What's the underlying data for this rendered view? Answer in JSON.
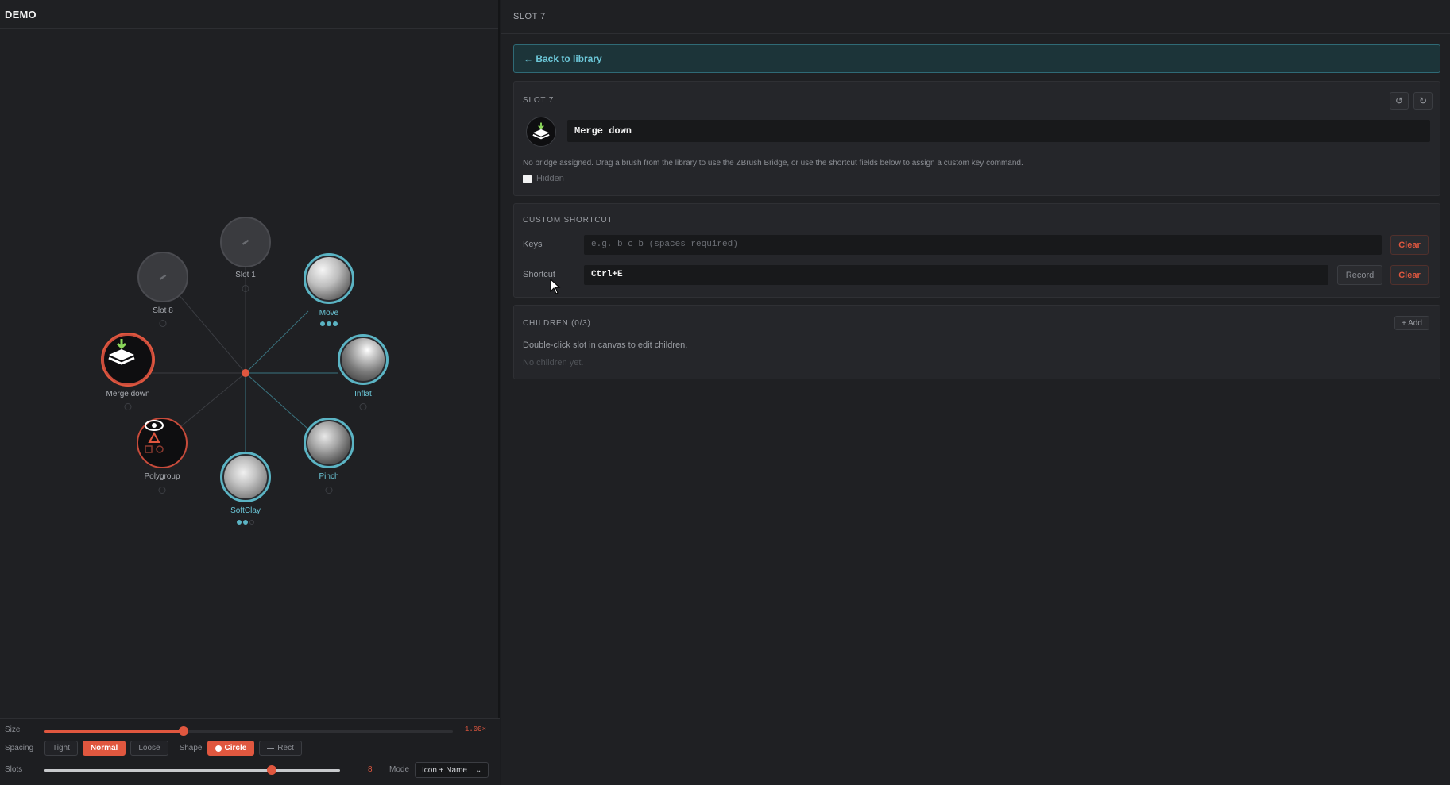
{
  "left_title": "DEMO",
  "canvas": {
    "slots": [
      {
        "label": "Slot 1",
        "kind": "empty"
      },
      {
        "label": "Move",
        "kind": "brush"
      },
      {
        "label": "Inflat",
        "kind": "brush"
      },
      {
        "label": "Pinch",
        "kind": "brush"
      },
      {
        "label": "SoftClay",
        "kind": "brush"
      },
      {
        "label": "Polygroup",
        "kind": "command",
        "icon": "eye-triangle-squares-icon"
      },
      {
        "label": "Merge down",
        "kind": "command",
        "icon": "layers-merge-icon",
        "active": true
      },
      {
        "label": "Slot 8",
        "kind": "empty"
      }
    ]
  },
  "controls": {
    "size_label": "Size",
    "size_value_text": "1.00×",
    "size_fraction": 0.34,
    "spacing_label": "Spacing",
    "spacing_options": [
      "Tight",
      "Normal",
      "Loose"
    ],
    "spacing_selected": "Normal",
    "shape_label": "Shape",
    "shape_circle": "Circle",
    "shape_rect": "Rect",
    "shape_selected": "Circle",
    "slots_label": "Slots",
    "slots_value": "8",
    "slots_fraction": 0.77,
    "mode_label": "Mode",
    "mode_value": "Icon + Name"
  },
  "right": {
    "header": "SLOT 7",
    "back_label": "← Back to library",
    "slot_card": {
      "title": "SLOT 7",
      "name_value": "Merge down",
      "help_text": "No bridge assigned. Drag a brush from the library to use the ZBrush Bridge, or use the shortcut fields below to assign a custom key command.",
      "hidden_label": "Hidden"
    },
    "shortcut_card": {
      "title": "CUSTOM SHORTCUT",
      "keys_label": "Keys",
      "keys_placeholder": "e.g. b c b (spaces required)",
      "shortcut_label": "Shortcut",
      "shortcut_value": "Ctrl+E",
      "record_label": "Record",
      "clear_label": "Clear"
    },
    "children_card": {
      "title": "CHILDREN (0/3)",
      "add_label": "+ Add",
      "hint": "Double-click slot in canvas to edit children.",
      "empty": "No children yet."
    }
  },
  "colors": {
    "accent": "#e0573f",
    "brush": "#5bb4c4",
    "back_text": "#6cc7d8"
  }
}
